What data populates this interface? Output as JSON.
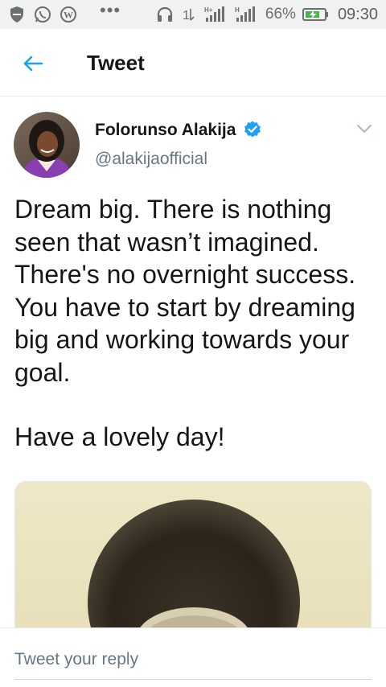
{
  "status_bar": {
    "left_icons": [
      "shield-icon",
      "whatsapp-icon",
      "wordpress-icon"
    ],
    "dots": "•••",
    "headphones_icon": "headphones-icon",
    "data_arrows": "1l",
    "network_label_1": "H+",
    "network_label_2": "H",
    "battery_pct": "66%",
    "time": "09:30"
  },
  "header": {
    "title": "Tweet"
  },
  "tweet": {
    "author_name": "Folorunso Alakija",
    "author_handle": "@alakijaofficial",
    "verified": true,
    "text_p1": "Dream big. There is nothing seen that wasn’t imagined. There's no overnight success. You have to start by dreaming big and working towards your goal.",
    "text_p2": "Have a lovely day!"
  },
  "reply": {
    "placeholder": "Tweet your reply"
  },
  "colors": {
    "accent": "#1da1f2",
    "text": "#14171a",
    "secondary": "#657786"
  }
}
